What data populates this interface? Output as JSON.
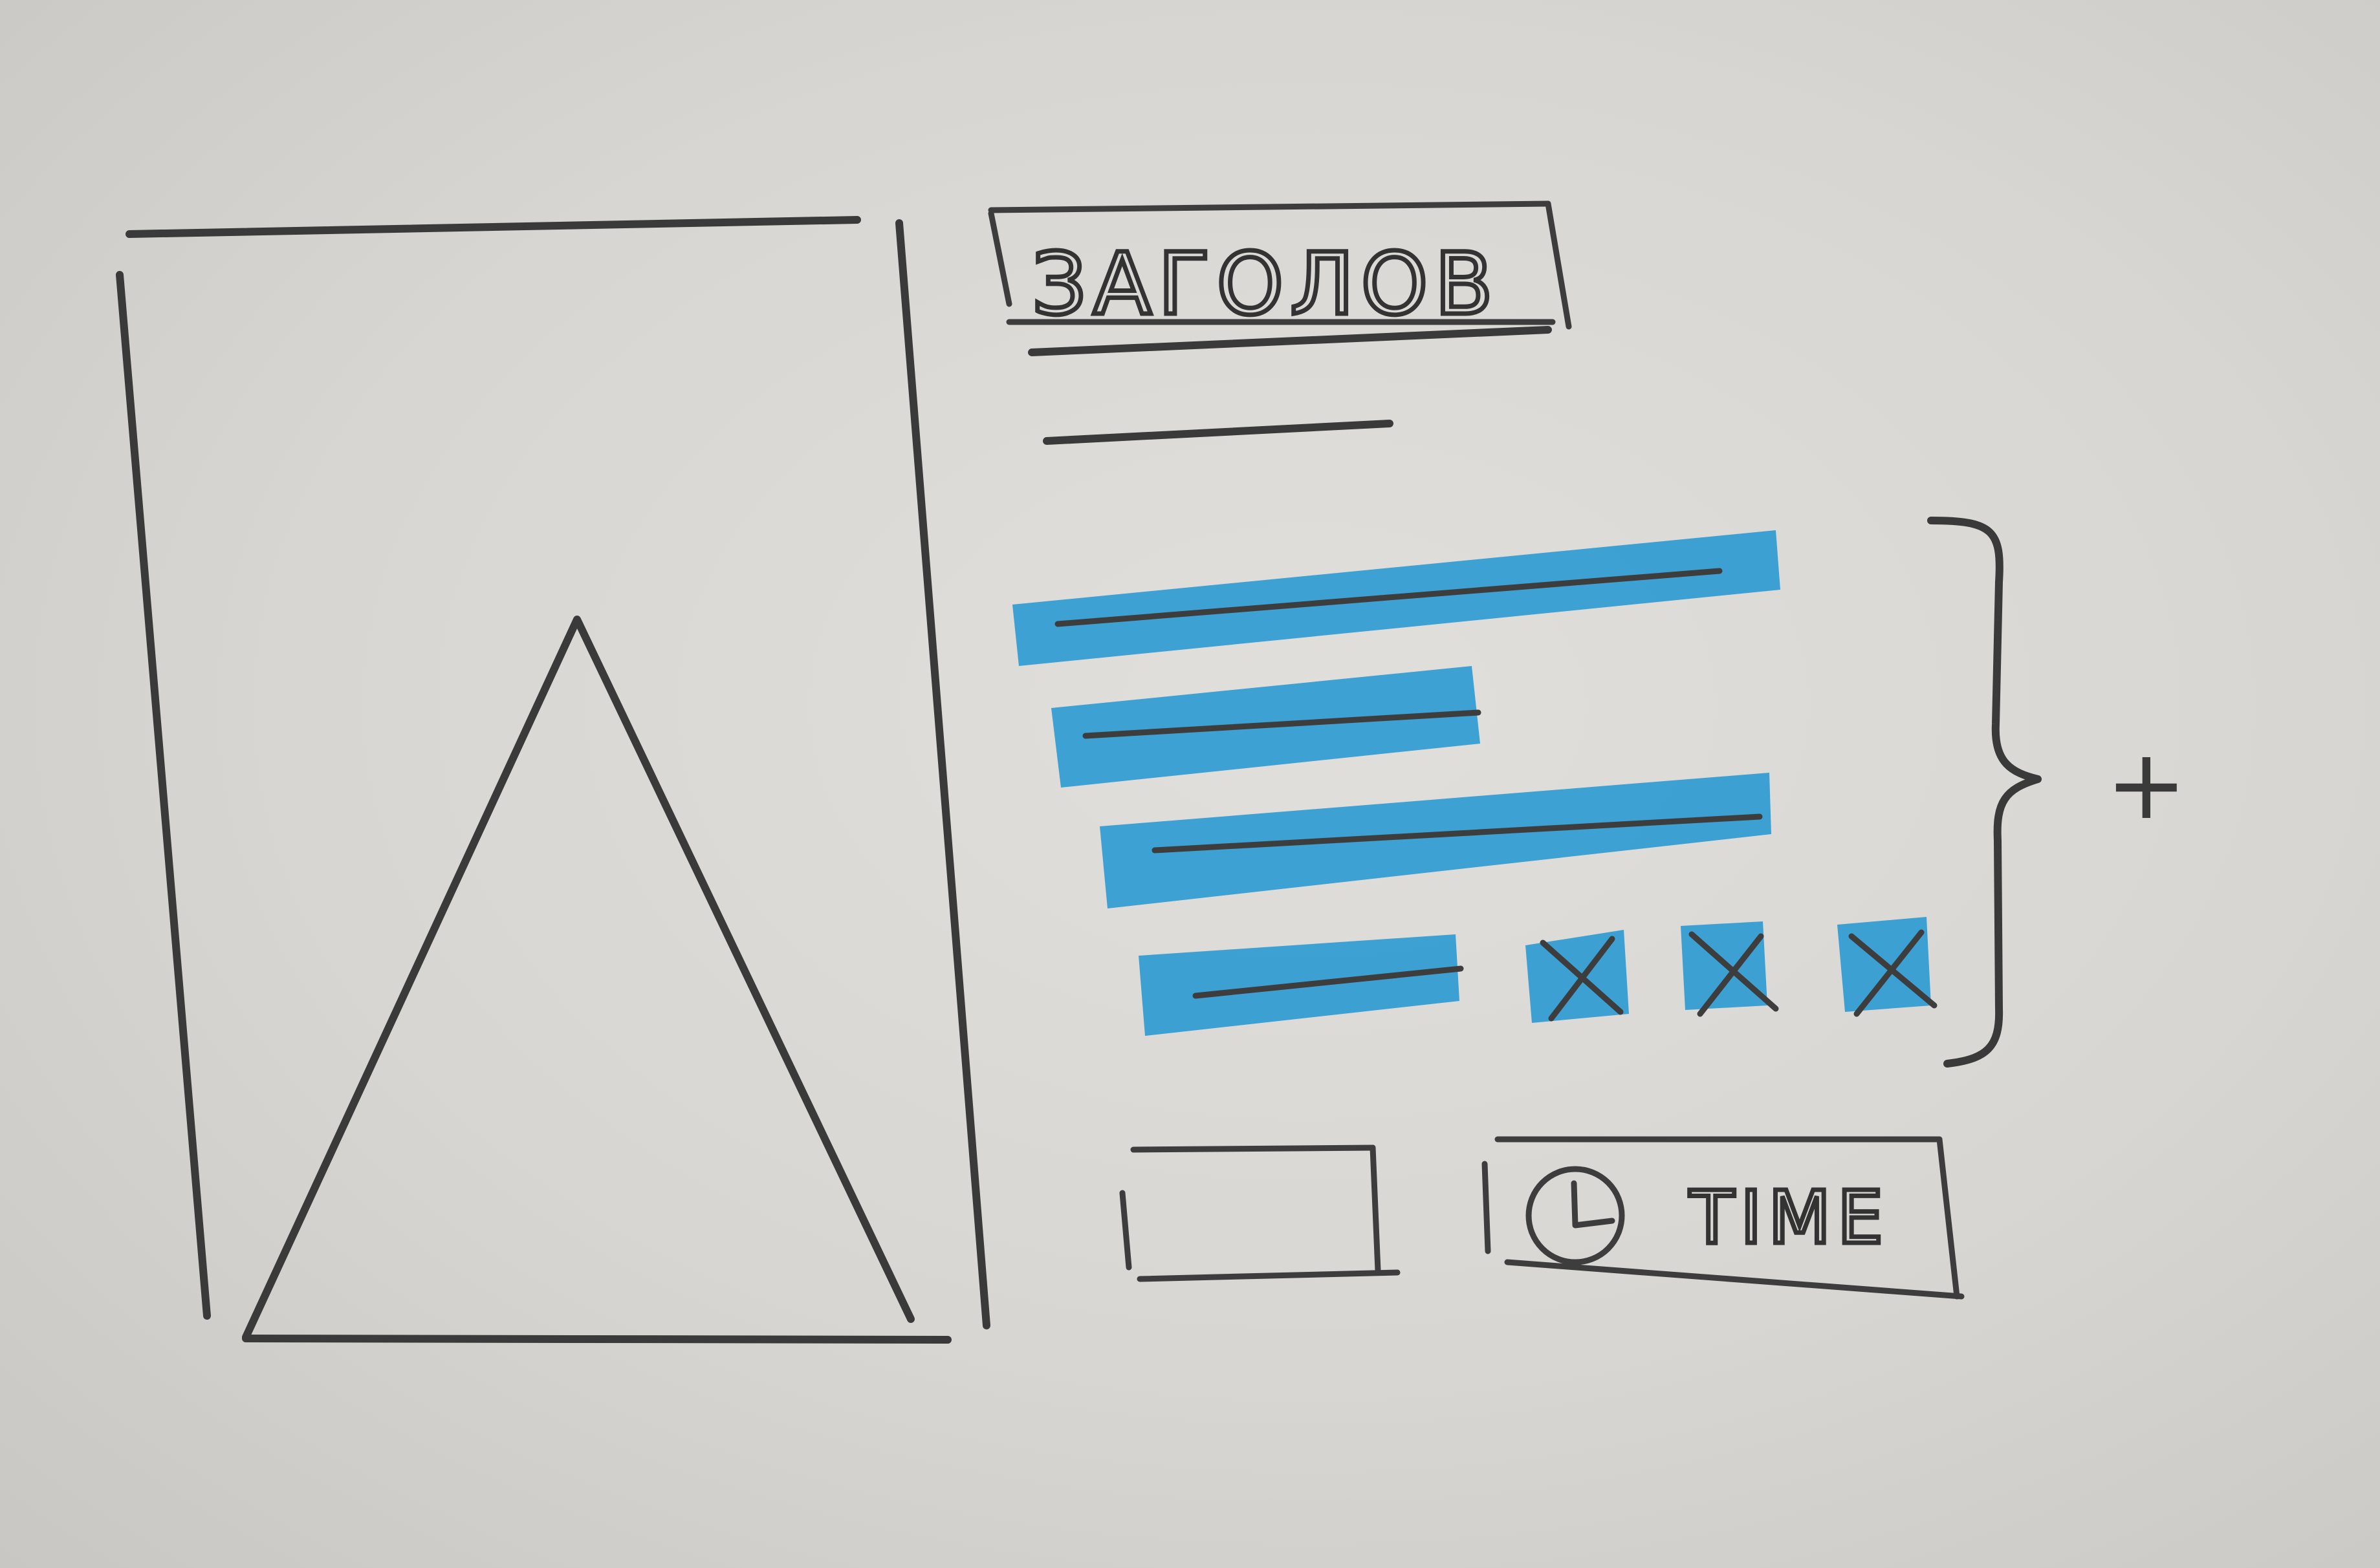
{
  "title_box": {
    "text": "ЗАГОЛОВ"
  },
  "time_button": {
    "label": "TIME",
    "icon": "clock-icon"
  },
  "expand_symbol": "+",
  "image_placeholder": {
    "icon": "image-placeholder-triangle"
  },
  "list_rows": [
    {
      "style": "highlighted-text-line"
    },
    {
      "style": "highlighted-text-line"
    },
    {
      "style": "highlighted-text-line"
    },
    {
      "style": "highlighted-text-line",
      "extras": [
        "x-box",
        "x-box",
        "x-box"
      ]
    }
  ],
  "colors": {
    "paper": "#d9d7d3",
    "pencil": "#3a3a3a",
    "highlight": "#2f9bd2"
  }
}
